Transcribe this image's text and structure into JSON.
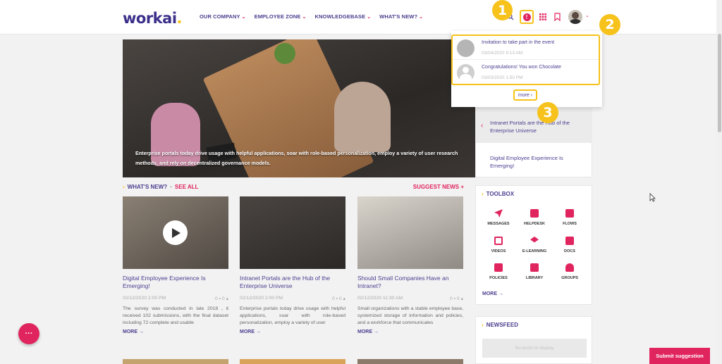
{
  "header": {
    "logo": "workai",
    "logo_dot": ".",
    "nav": [
      "OUR COMPANY",
      "EMPLOYEE ZONE",
      "KNOWLEDGEBASE",
      "WHAT'S NEW?"
    ],
    "alert_glyph": "!"
  },
  "markers": [
    "1",
    "2",
    "3"
  ],
  "hero": {
    "caption": "Enterprise portals today drive usage with helpful applications, soar with role-based personalization, employ a variety of user research methods, and rely on decentralized governance models."
  },
  "section": {
    "title": "WHAT'S NEW?",
    "see_all": "SEE ALL",
    "suggest": "SUGGEST NEWS +"
  },
  "cards": [
    {
      "title": "Digital Employee Experience Is Emerging!",
      "date": "02/12/2020 2:00 PM",
      "counts": "0 ▪  0 ▴",
      "desc": "The survey was conducted in late 2018 , it received 102 submissions, with the final dataset including 72 complete and usable",
      "more": "MORE →"
    },
    {
      "title": "Intranet Portals are the Hub of the Enterprise Universe",
      "date": "02/12/2020 2:00 PM",
      "counts": "0 ▪  0 ▴",
      "desc": "Enterprise portals today drive usage with helpful applications, soar with role-based personalization, employ a variety of user",
      "more": "MORE →"
    },
    {
      "title": "Should Small Companies Have an Intranet?",
      "date": "02/12/2020 11:30 AM",
      "counts": "0 ▪  0 ▴",
      "desc": "Small organizations with a stable employee base, systemized storage of information and policies, and a workforce that communicates",
      "more": "MORE →"
    }
  ],
  "slider": {
    "items": [
      "Intranet Portals are the Hub of the Enterprise Universe",
      "Digital Employee Experience Is Emerging!"
    ],
    "arrow": "‹"
  },
  "toolbox": {
    "title": "TOOLBOX",
    "items": [
      "MESSAGES",
      "HELPDESK",
      "FLOWS",
      "VIDEOS",
      "E-LEARNING",
      "DOCS",
      "POLICIES",
      "LIBRARY",
      "GROUPS"
    ],
    "more": "MORE →"
  },
  "newsfeed": {
    "title": "NEWSFEED",
    "empty": "No posts to display"
  },
  "notifications": {
    "items": [
      {
        "text": "Invitation to take part in the event",
        "date": "03/04/2020 9:13 AM"
      },
      {
        "text": "Congratulations! You won Chocolate",
        "date": "03/03/2020 1:50 PM"
      }
    ],
    "more": "more ›"
  },
  "fab_label": "···",
  "submit_label": "Submit suggestion",
  "colors": {
    "accent": "#e0245e",
    "brand": "#3b2f8a",
    "highlight": "#f6c21b"
  }
}
